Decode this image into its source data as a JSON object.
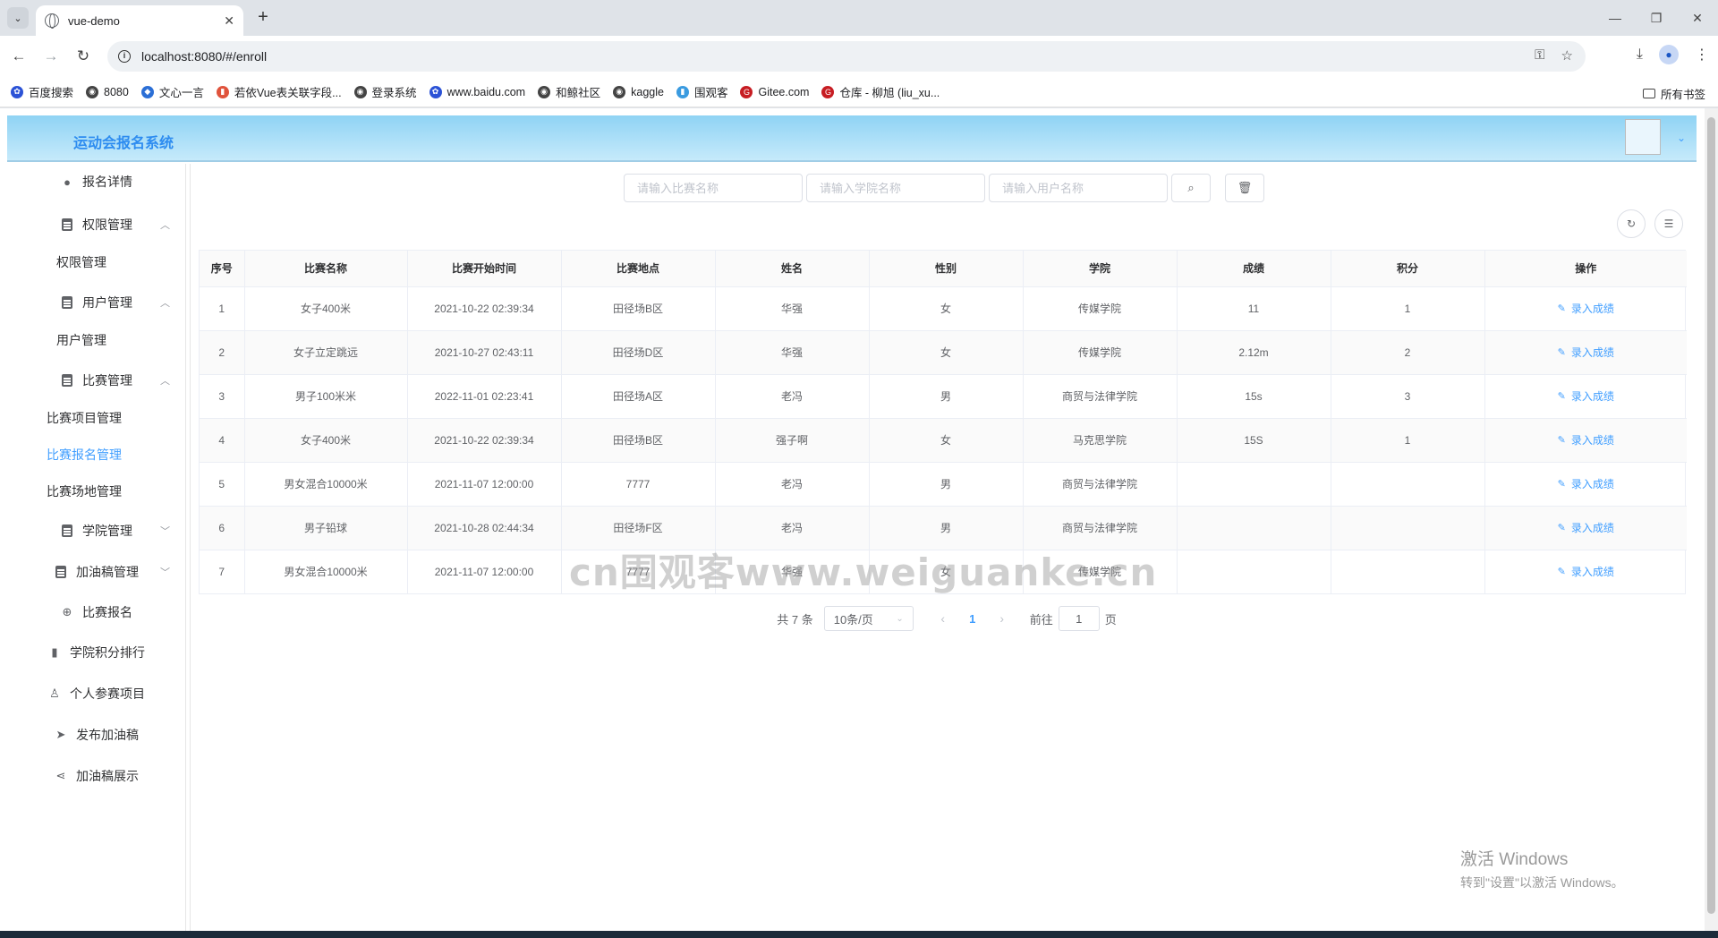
{
  "browser": {
    "tab_title": "vue-demo",
    "url": "localhost:8080/#/enroll",
    "bookmarks": [
      {
        "label": "百度搜索",
        "icon": "paw-icon",
        "color": "#2b52d6"
      },
      {
        "label": "8080",
        "icon": "globe-icon",
        "color": "#444444"
      },
      {
        "label": "文心一言",
        "icon": "cube-icon",
        "color": "#2b6fd6"
      },
      {
        "label": "若依Vue表关联字段...",
        "icon": "bookmark-icon",
        "color": "#e0533c"
      },
      {
        "label": "登录系统",
        "icon": "globe-icon",
        "color": "#444444"
      },
      {
        "label": "www.baidu.com",
        "icon": "paw-icon",
        "color": "#2b52d6"
      },
      {
        "label": "和鲸社区",
        "icon": "globe-icon",
        "color": "#444444"
      },
      {
        "label": "kaggle",
        "icon": "globe-icon",
        "color": "#444444"
      },
      {
        "label": "围观客",
        "icon": "bookmark-icon",
        "color": "#3a9be0"
      },
      {
        "label": "Gitee.com",
        "icon": "gitee-icon",
        "color": "#c71d23"
      },
      {
        "label": "仓库 - 柳旭 (liu_xu...",
        "icon": "gitee-icon",
        "color": "#c71d23"
      }
    ],
    "all_bookmarks": "所有书签"
  },
  "header": {
    "title": "运动会报名系统"
  },
  "sidebar": {
    "items": [
      {
        "type": "item",
        "label": "报名详情",
        "icon": "location-icon"
      },
      {
        "type": "group",
        "label": "权限管理",
        "icon": "clipboard-icon",
        "expanded": true
      },
      {
        "type": "sub",
        "label": "权限管理"
      },
      {
        "type": "group",
        "label": "用户管理",
        "icon": "clipboard-icon",
        "expanded": true
      },
      {
        "type": "sub",
        "label": "用户管理"
      },
      {
        "type": "group",
        "label": "比赛管理",
        "icon": "clipboard-icon",
        "expanded": true
      },
      {
        "type": "sub",
        "label": "比赛项目管理"
      },
      {
        "type": "sub",
        "label": "比赛报名管理",
        "active": true
      },
      {
        "type": "sub",
        "label": "比赛场地管理"
      },
      {
        "type": "group",
        "label": "学院管理",
        "icon": "clipboard-icon",
        "expanded": false
      },
      {
        "type": "group",
        "label": "加油稿管理",
        "icon": "clipboard-icon",
        "expanded": false
      },
      {
        "type": "item",
        "label": "比赛报名",
        "icon": "plus-circle-icon"
      },
      {
        "type": "item",
        "label": "学院积分排行",
        "icon": "bar-chart-icon"
      },
      {
        "type": "item",
        "label": "个人参赛项目",
        "icon": "user-icon"
      },
      {
        "type": "item",
        "label": "发布加油稿",
        "icon": "send-icon"
      },
      {
        "type": "item",
        "label": "加油稿展示",
        "icon": "share-icon"
      }
    ]
  },
  "search": {
    "match_placeholder": "请输入比赛名称",
    "college_placeholder": "请输入学院名称",
    "user_placeholder": "请输入用户名称"
  },
  "table": {
    "columns": [
      "序号",
      "比赛名称",
      "比赛开始时间",
      "比赛地点",
      "姓名",
      "性别",
      "学院",
      "成绩",
      "积分",
      "操作"
    ],
    "action_label": "录入成绩",
    "rows": [
      [
        "1",
        "女子400米",
        "2021-10-22 02:39:34",
        "田径场B区",
        "华强",
        "女",
        "传媒学院",
        "11",
        "1"
      ],
      [
        "2",
        "女子立定跳远",
        "2021-10-27 02:43:11",
        "田径场D区",
        "华强",
        "女",
        "传媒学院",
        "2.12m",
        "2"
      ],
      [
        "3",
        "男子100米米",
        "2022-11-01 02:23:41",
        "田径场A区",
        "老冯",
        "男",
        "商贸与法律学院",
        "15s",
        "3"
      ],
      [
        "4",
        "女子400米",
        "2021-10-22 02:39:34",
        "田径场B区",
        "强子啊",
        "女",
        "马克思学院",
        "15S",
        "1"
      ],
      [
        "5",
        "男女混合10000米",
        "2021-11-07 12:00:00",
        "7777",
        "老冯",
        "男",
        "商贸与法律学院",
        "",
        ""
      ],
      [
        "6",
        "男子铅球",
        "2021-10-28 02:44:34",
        "田径场F区",
        "老冯",
        "男",
        "商贸与法律学院",
        "",
        ""
      ],
      [
        "7",
        "男女混合10000米",
        "2021-11-07 12:00:00",
        "7777",
        "华强",
        "女",
        "传媒学院",
        "",
        ""
      ]
    ]
  },
  "pagination": {
    "total": "共 7 条",
    "page_size": "10条/页",
    "current_page": "1",
    "goto_label": "前往",
    "goto_value": "1",
    "page_unit": "页"
  },
  "watermark": "cn围观客www.weiguanke.cn",
  "windows_activation": {
    "line1": "激活 Windows",
    "line2": "转到\"设置\"以激活 Windows。"
  }
}
